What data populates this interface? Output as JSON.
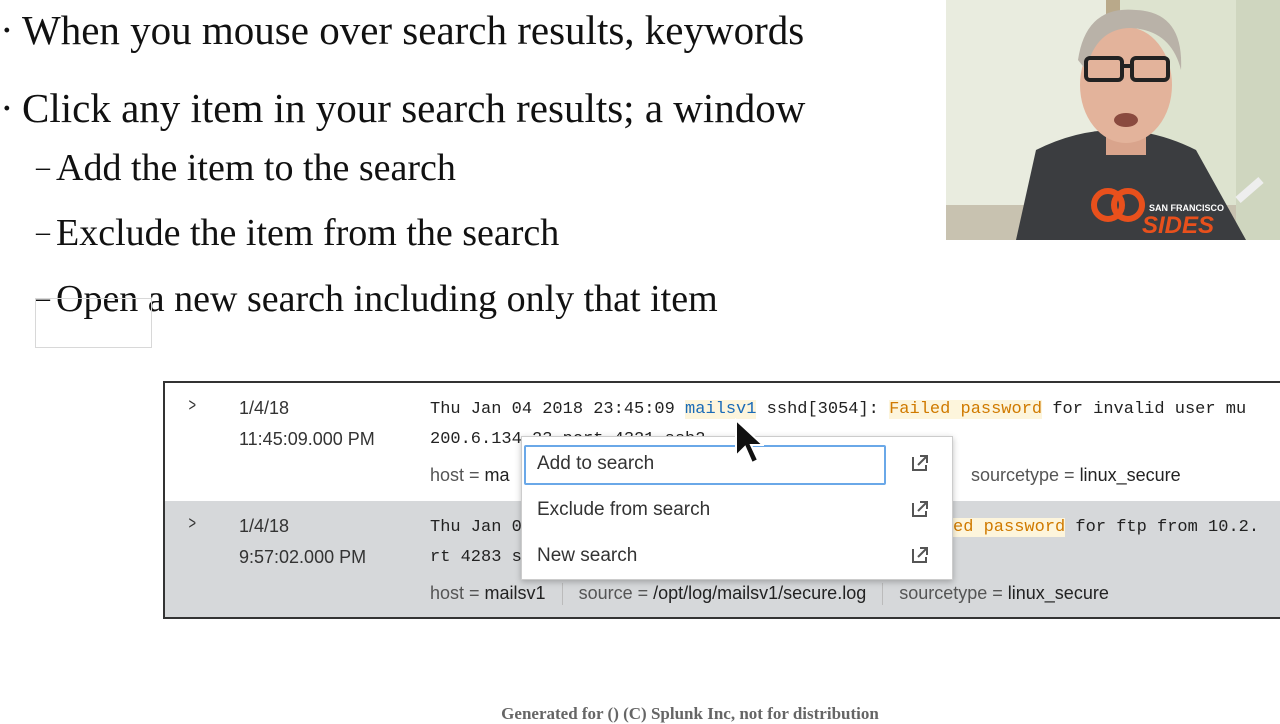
{
  "slide": {
    "bullets": [
      "When you mouse over search results, keywords",
      "Click any item in your search results; a window"
    ],
    "sub_bullets": [
      "Add the item to the search",
      "Exclude the item from the search",
      "Open a new search including only that item"
    ],
    "bullet_glyph": "·",
    "dash_glyph": "–",
    "footer": "Generated for () (C) Splunk Inc, not for distribution"
  },
  "webcam": {
    "shirt_text": "SIDES",
    "shirt_small_text": "SAN FRANCISCO",
    "shirt_logo": "38"
  },
  "events": [
    {
      "date": "1/4/18",
      "time": "11:45:09.000 PM",
      "raw_line1_prefix": "Thu Jan 04 2018 23:45:09 ",
      "raw_line1_host": "mailsv1",
      "raw_line1_mid": " sshd[3054]: ",
      "raw_line1_hl": "Failed password",
      "raw_line1_suffix": " for invalid user mu",
      "raw_line2": "200.6.134.23 port 4321 ssh2",
      "host_key": "host = ",
      "host_val": "ma",
      "sourcetype_key": "sourcetype = ",
      "sourcetype_val": "linux_secure"
    },
    {
      "date": "1/4/18",
      "time": "9:57:02.000 PM",
      "raw_line1_prefix": "Thu Jan 0",
      "raw_line1_hl": "ed password",
      "raw_line1_suffix": " for ftp from 10.2.",
      "raw_line2": "rt 4283 s",
      "host_key": "host = ",
      "host_val": "mailsv1",
      "source_key": "source = ",
      "source_val": "/opt/log/mailsv1/secure.log",
      "sourcetype_key": "sourcetype = ",
      "sourcetype_val": "linux_secure"
    }
  ],
  "context_menu": {
    "items": [
      {
        "label": "Add to search"
      },
      {
        "label": "Exclude from search"
      },
      {
        "label": "New search"
      }
    ]
  },
  "colors": {
    "keyword_blue": "#1a6bb8",
    "keyword_orange": "#d07a00",
    "highlight_bg": "#fdf5dc",
    "selected_row_bg": "#d6d8da",
    "focus_border": "#6aa8e8"
  }
}
